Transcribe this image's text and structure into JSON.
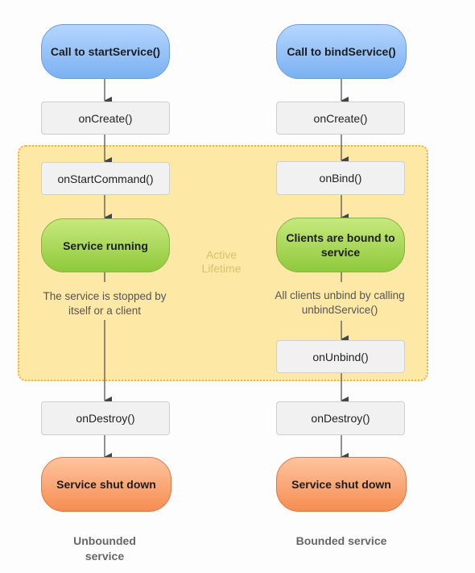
{
  "active_lifetime_label": "Active Lifetime",
  "columns": [
    {
      "start": "Call to startService()",
      "steps": [
        "onCreate()",
        "onStartCommand()"
      ],
      "running": "Service running",
      "note": "The service is stopped by itself or a client",
      "after_note_steps": [],
      "destroy": "onDestroy()",
      "end": "Service shut down",
      "caption": "Unbounded service"
    },
    {
      "start": "Call to bindService()",
      "steps": [
        "onCreate()",
        "onBind()"
      ],
      "running": "Clients are bound to service",
      "note": "All clients unbind by calling unbindService()",
      "after_note_steps": [
        "onUnbind()"
      ],
      "destroy": "onDestroy()",
      "end": "Service shut down",
      "caption": "Bounded service"
    }
  ],
  "colors": {
    "start": "#8dbdf6",
    "running": "#a6d655",
    "end": "#f8a473",
    "active_area": "#fde8a6"
  }
}
